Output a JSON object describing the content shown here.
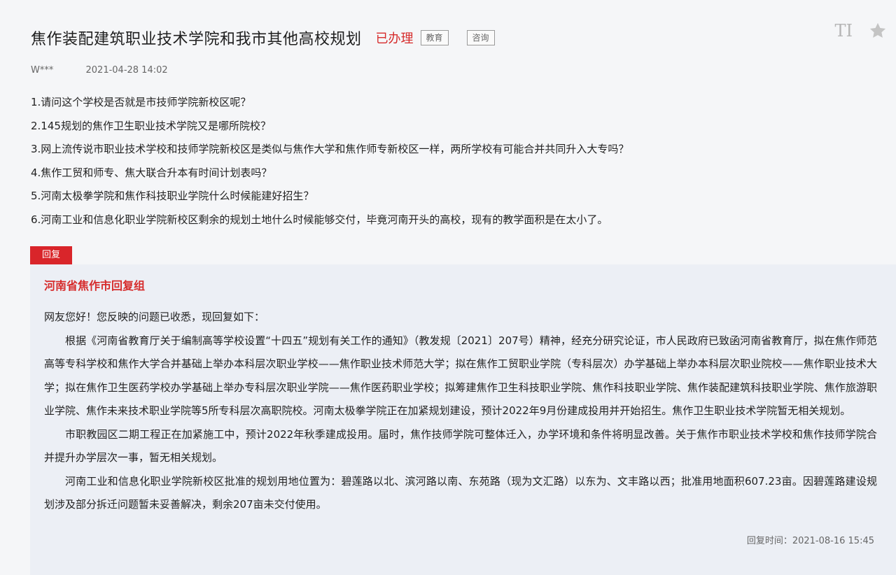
{
  "header": {
    "title": "焦作装配建筑职业技术学院和我市其他高校规划",
    "status": "已办理",
    "tags": [
      "教育",
      "咨询"
    ]
  },
  "tools": {
    "font_icon": "TI",
    "star_icon": "star-icon"
  },
  "meta": {
    "user": "W***",
    "datetime": "2021-04-28 14:02"
  },
  "questions": [
    "1.请问这个学校是否就是市技师学院新校区呢？",
    "2.145规划的焦作卫生职业技术学院又是哪所院校？",
    "3.网上流传说市职业技术学校和技师学院新校区是类似与焦作大学和焦作师专新校区一样，两所学校有可能合并共同升入大专吗？",
    "4.焦作工贸和师专、焦大联合升本有时间计划表吗？",
    "5.河南太极拳学院和焦作科技职业学院什么时候能建好招生？",
    "6.河南工业和信息化职业学院新校区剩余的规划土地什么时候能够交付，毕竟河南开头的高校，现有的教学面积是在太小了。"
  ],
  "reply": {
    "badge": "回复",
    "org": "河南省焦作市回复组",
    "greeting": "网友您好！您反映的问题已收悉，现回复如下：",
    "paragraphs": [
      "根据《河南省教育厅关于编制高等学校设置“十四五”规划有关工作的通知》（教发规〔2021〕207号）精神，经充分研究论证，市人民政府已致函河南省教育厅，拟在焦作师范高等专科学校和焦作大学合并基础上举办本科层次职业学校——焦作职业技术师范大学；拟在焦作工贸职业学院（专科层次）办学基础上举办本科层次职业院校——焦作职业技术大学；拟在焦作卫生医药学校办学基础上举办专科层次职业学院——焦作医药职业学校；拟筹建焦作卫生科技职业学院、焦作科技职业学院、焦作装配建筑科技职业学院、焦作旅游职业学院、焦作未来技术职业学院等5所专科层次高职院校。河南太极拳学院正在加紧规划建设，预计2022年9月份建成投用并开始招生。焦作卫生职业技术学院暂无相关规划。",
      "市职教园区二期工程正在加紧施工中，预计2022年秋季建成投用。届时，焦作技师学院可整体迁入，办学环境和条件将明显改善。关于焦作市职业技术学校和焦作技师学院合并提升办学层次一事，暂无相关规划。",
      "河南工业和信息化职业学院新校区批准的规划用地位置为：碧莲路以北、滨河路以南、东苑路（现为文汇路）以东为、文丰路以西；批准用地面积607.23亩。因碧莲路建设规划涉及部分拆迁问题暂未妥善解决，剩余207亩未交付使用。"
    ],
    "time": "回复时间：2021-08-16 15:45"
  }
}
